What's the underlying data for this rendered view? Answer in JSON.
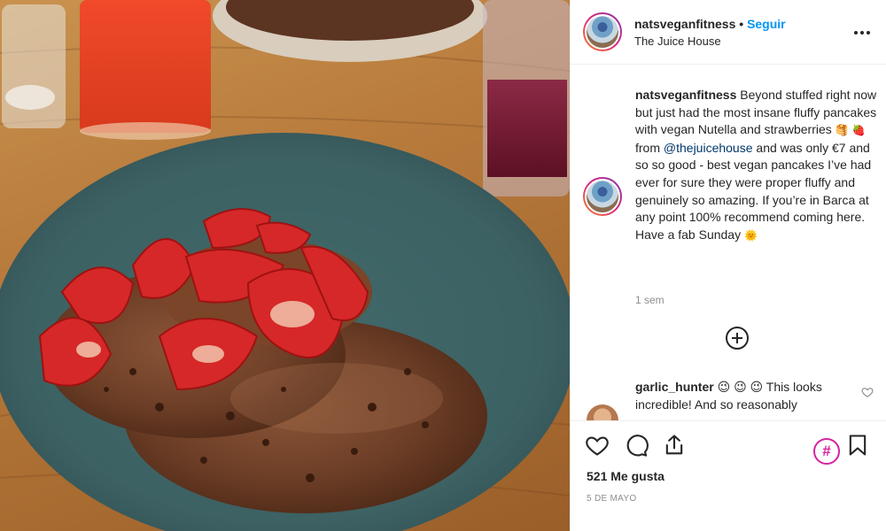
{
  "post": {
    "username": "natsveganfitness",
    "separator": "•",
    "follow_label": "Seguir",
    "location": "The Juice House",
    "more_icon": "more-options-icon"
  },
  "caption": {
    "username": "natsveganfitness",
    "text_1": " Beyond stuffed right now but just had the most insane fluffy pancakes with vegan Nutella and strawberries ",
    "emoji_1": "🥞",
    "emoji_2": "🍓",
    "text_2": " from ",
    "mention": "@thejuicehouse",
    "text_3": " and was only €7 and so so good - best vegan pancakes I’ve had ever for sure they were proper fluffy and genuinely so amazing. If you’re in Barca at any point 100% recommend coming here. Have a fab Sunday ",
    "emoji_3": "🌞",
    "time_ago": "1 sem"
  },
  "comments": [
    {
      "username": "garlic_hunter",
      "emojis": " 😉 😉 😉 ",
      "text": " This looks incredible! And so reasonably"
    }
  ],
  "actions": {
    "like_icon": "heart-icon",
    "comment_icon": "comment-icon",
    "share_icon": "share-icon",
    "hashtag_label": "#",
    "save_icon": "bookmark-icon",
    "likes": "521 Me gusta",
    "date": "5 DE MAYO"
  },
  "colors": {
    "link": "#0095f6",
    "mention": "#00376b",
    "muted": "#8e8e8e",
    "hashtag_accent": "#d6249f"
  }
}
